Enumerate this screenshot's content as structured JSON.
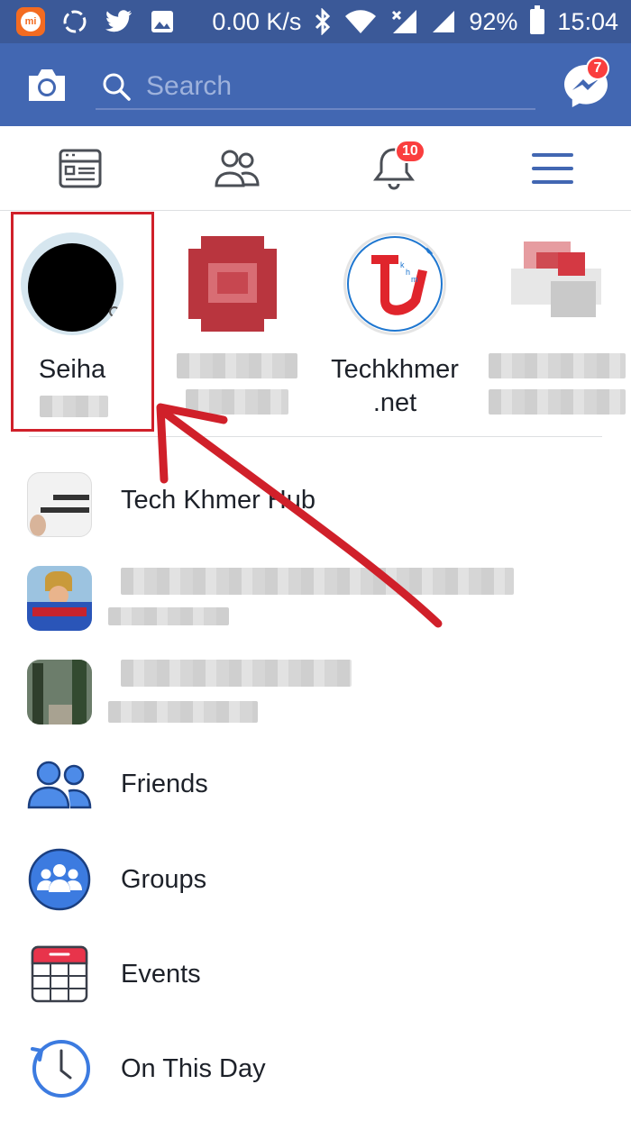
{
  "status_bar": {
    "mi_label": "mi",
    "speed": "0.00 K/s",
    "battery": "92%",
    "time": "15:04"
  },
  "header": {
    "search_placeholder": "Search",
    "messenger_badge": "7"
  },
  "tabs": {
    "notifications_badge": "10"
  },
  "shortcuts": [
    {
      "name": "Seiha"
    },
    {
      "name": ""
    },
    {
      "name": "Techkhmer\n.net",
      "line1": "Techkhmer",
      "line2": ".net"
    },
    {
      "name": ""
    }
  ],
  "list": {
    "tech_khmer_hub": "Tech Khmer Hub",
    "friends": "Friends",
    "groups": "Groups",
    "events": "Events",
    "on_this_day": "On This Day"
  },
  "colors": {
    "status_bar": "#3b5998",
    "header": "#4267b2",
    "badge": "#fa3e3e",
    "annotation": "#d0202a"
  }
}
